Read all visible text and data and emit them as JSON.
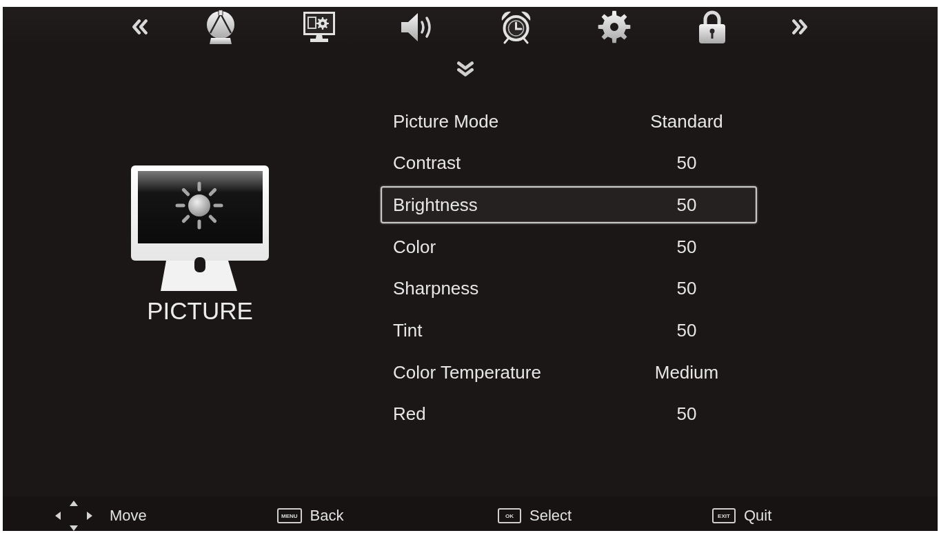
{
  "section": {
    "title": "PICTURE"
  },
  "menu": [
    {
      "label": "Picture Mode",
      "value": "Standard",
      "selected": false
    },
    {
      "label": "Contrast",
      "value": "50",
      "selected": false
    },
    {
      "label": "Brightness",
      "value": "50",
      "selected": true
    },
    {
      "label": "Color",
      "value": "50",
      "selected": false
    },
    {
      "label": "Sharpness",
      "value": "50",
      "selected": false
    },
    {
      "label": "Tint",
      "value": "50",
      "selected": false
    },
    {
      "label": "Color Temperature",
      "value": "Medium",
      "selected": false
    },
    {
      "label": "Red",
      "value": "50",
      "selected": false
    }
  ],
  "footer": [
    {
      "kind": "dpad",
      "label": "Move"
    },
    {
      "kind": "key",
      "key": "MENU",
      "label": "Back"
    },
    {
      "kind": "key",
      "key": "OK",
      "label": "Select"
    },
    {
      "kind": "key",
      "key": "EXIT",
      "label": "Quit"
    }
  ]
}
